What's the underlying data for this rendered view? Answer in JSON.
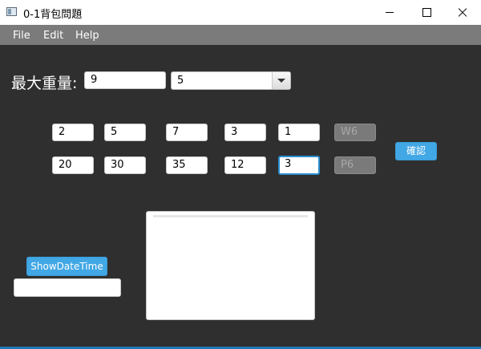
{
  "window": {
    "title": "0-1背包問題"
  },
  "menu": {
    "items": [
      "File",
      "Edit",
      "Help"
    ]
  },
  "form": {
    "max_weight_label": "最大重量:",
    "max_weight_value": "9",
    "item_count_selected": "5",
    "weights": [
      "2",
      "5",
      "7",
      "3",
      "1"
    ],
    "weight_placeholder": "W6",
    "values": [
      "20",
      "30",
      "35",
      "12",
      "3"
    ],
    "value_placeholder": "P6",
    "confirm_label": "確認"
  },
  "bottom": {
    "show_datetime_label": "ShowDateTime",
    "datetime_value": "",
    "result_text": ""
  },
  "colors": {
    "accent": "#41a7e5",
    "background": "#2f2f2f",
    "menubar": "#7b7b7b"
  }
}
